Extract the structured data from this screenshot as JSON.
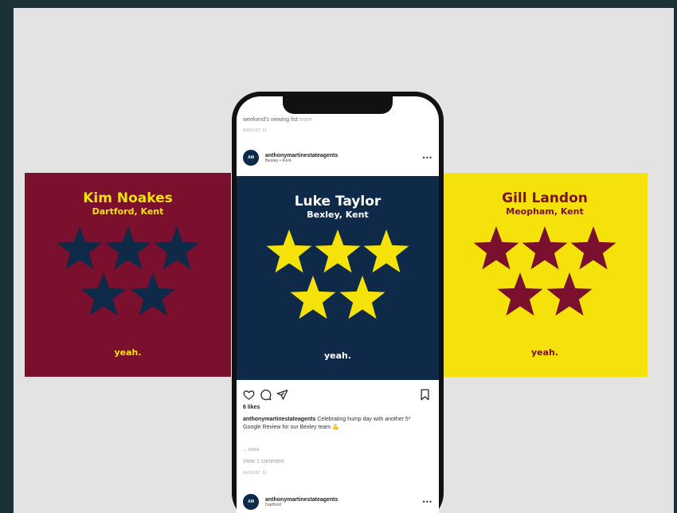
{
  "cards": {
    "left": {
      "name": "Kim Noakes",
      "location": "Dartford, Kent",
      "tagline": "yeah.",
      "bg": "#7a0f2e",
      "text_color": "#f5e20a",
      "star_color": "#0f2a48",
      "rating": 5
    },
    "center": {
      "name": "Luke Taylor",
      "location": "Bexley, Kent",
      "tagline": "yeah.",
      "bg": "#0f2a48",
      "text_color": "#ffffff",
      "star_color": "#f5e20a",
      "rating": 5
    },
    "right": {
      "name": "Gill Landon",
      "location": "Meopham, Kent",
      "tagline": "yeah.",
      "bg": "#f5e20a",
      "text_color": "#7a0f2e",
      "star_color": "#7a0f2e",
      "rating": 5
    }
  },
  "phone": {
    "previous_caption": "weekend's viewing list",
    "previous_caption_more": "more",
    "previous_date": "AUGUST 11",
    "post": {
      "avatar_text": "AM",
      "username": "anthonymartinestateagents",
      "location": "Bexley • Kent",
      "menu": "•••",
      "likes": "6 likes",
      "caption_user": "anthonymartinestateagents",
      "caption_text": "Celebrating hump day with another 5* Google Review for our Bexley team 💪",
      "more": "... more",
      "view_comments": "View 1 comment",
      "date": "AUGUST 11"
    },
    "next_post": {
      "avatar_text": "AM",
      "username": "anthonymartinestateagents",
      "location": "Dartford",
      "menu": "•••"
    },
    "icons": [
      "heart-icon",
      "comment-icon",
      "share-icon",
      "bookmark-icon"
    ]
  }
}
